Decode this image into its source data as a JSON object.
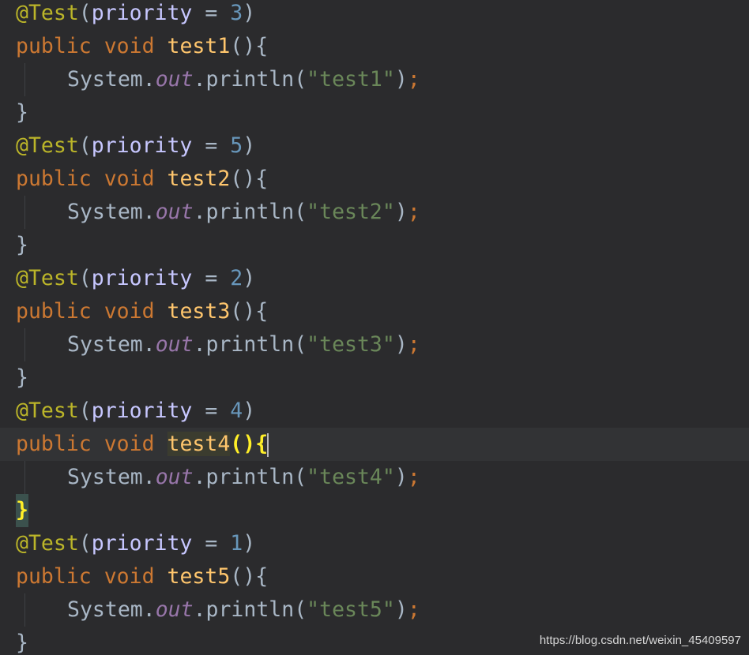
{
  "code": {
    "annotation": "@Test",
    "priority_param": "priority",
    "equals": " = ",
    "keyword_public": "public",
    "keyword_void": "void",
    "system": "System.",
    "out": "out",
    "println": ".println(",
    "open_paren_brace": "(){",
    "close_paren": ")",
    "close_paren_semi": ")",
    "semicolon": ";",
    "close_brace": "}",
    "methods": [
      {
        "priority": "3",
        "name": "test1",
        "string": "\"test1\""
      },
      {
        "priority": "5",
        "name": "test2",
        "string": "\"test2\""
      },
      {
        "priority": "2",
        "name": "test3",
        "string": "\"test3\""
      },
      {
        "priority": "4",
        "name": "test4",
        "string": "\"test4\""
      },
      {
        "priority": "1",
        "name": "test5",
        "string": "\"test5\""
      }
    ]
  },
  "watermark": "https://blog.csdn.net/weixin_45409597",
  "colors": {
    "background": "#2b2b2d",
    "annotation": "#bbb529",
    "keyword": "#cc7832",
    "method": "#ffc66d",
    "number": "#6897bb",
    "string": "#6a8759",
    "static_field": "#9876aa",
    "default_text": "#a9b7c6"
  }
}
